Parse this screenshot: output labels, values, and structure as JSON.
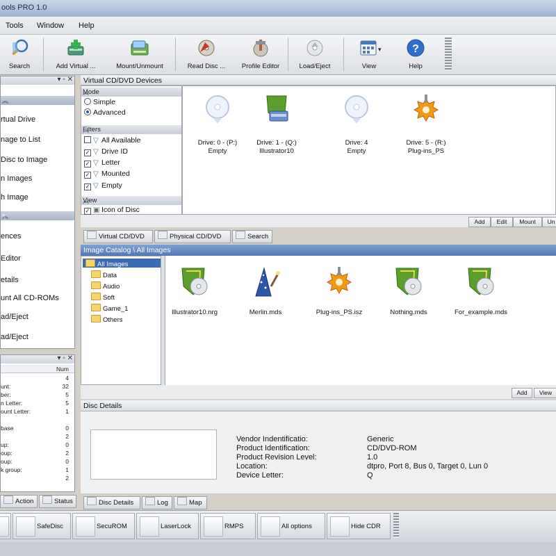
{
  "window": {
    "title": "ools PRO 1.0"
  },
  "menu": [
    "Tools",
    "Window",
    "Help"
  ],
  "toolbar": {
    "buttons": [
      "Search",
      "Add Virtual ...",
      "Mount/Unmount",
      "Read Disc ...",
      "Profile Editor",
      "Load/Eject",
      "View",
      "Help"
    ],
    "view_dropdown": "▾"
  },
  "left_tasks": {
    "group1": [
      "rtual Drive",
      "nage to List",
      "Disc to Image",
      "n Images",
      "h Image"
    ],
    "group2_header": "s",
    "group2": [
      "ences",
      "Editor",
      "etails",
      "unt All CD-ROMs",
      "ad/Eject",
      "ad/Eject"
    ]
  },
  "stats_table": {
    "header": [
      "",
      "Num"
    ],
    "rows": [
      {
        "label": "",
        "value": "4"
      },
      {
        "label": "unt:",
        "value": "32"
      },
      {
        "label": "ber:",
        "value": "5"
      },
      {
        "label": "n Letter:",
        "value": "5"
      },
      {
        "label": "ount Letter:",
        "value": "1"
      },
      {
        "label": "",
        "value": ""
      },
      {
        "label": "base",
        "value": "0"
      },
      {
        "label": "",
        "value": "2"
      },
      {
        "label": "up:",
        "value": "0"
      },
      {
        "label": "oup:",
        "value": "2"
      },
      {
        "label": "oup:",
        "value": "0"
      },
      {
        "label": "k group:",
        "value": "1"
      },
      {
        "label": "",
        "value": "2"
      }
    ],
    "tabs": [
      "Action",
      "Status"
    ]
  },
  "devices_panel": {
    "title": "Virtual CD/DVD Devices",
    "mode_header": "Mode",
    "mode_options": [
      "Simple",
      "Advanced"
    ],
    "filters_header": "Filters",
    "filters": [
      "All Available",
      "Drive ID",
      "Letter",
      "Mounted",
      "Empty"
    ],
    "view_header": "View",
    "view_options": [
      "Icon of Disc"
    ],
    "drives": [
      {
        "line1": "Drive: 0 - (P:)",
        "line2": "Empty",
        "icon": "disc-empty-icon"
      },
      {
        "line1": "Drive: 1 - (Q:)",
        "line2": "Illustrator10",
        "icon": "drive-shield-icon"
      },
      {
        "line1": "Drive: 4",
        "line2": "Empty",
        "icon": "disc-empty-icon"
      },
      {
        "line1": "Drive: 5 - (R:)",
        "line2": "Plug-ins_PS",
        "icon": "gear-plug-icon"
      }
    ],
    "buttons": [
      "Add",
      "Edit",
      "Mount",
      "Un"
    ]
  },
  "device_tabs": [
    "Virtual CD/DVD",
    "Physical CD/DVD",
    "Search"
  ],
  "catalog": {
    "title": "Image Catalog \\ All Images",
    "tree_root": "All Images",
    "tree": [
      "Data",
      "Audio",
      "Soft",
      "Game_1",
      "Others"
    ],
    "images": [
      {
        "label": "Illustrator10.nrg",
        "icon": "shield-disc-icon"
      },
      {
        "label": "Merlin.mds",
        "icon": "wizard-icon"
      },
      {
        "label": "Plug-ins_PS.isz",
        "icon": "gear-plug-icon"
      },
      {
        "label": "Nothing.mds",
        "icon": "shield-disc-icon"
      },
      {
        "label": "For_example.mds",
        "icon": "shield-disc-icon"
      }
    ],
    "buttons": [
      "Add",
      "View"
    ]
  },
  "disc_details": {
    "title": "Disc Details",
    "fields": [
      {
        "label": "Vendor Indentificatio:",
        "value": "Generic"
      },
      {
        "label": "Product Identification:",
        "value": "CD/DVD-ROM"
      },
      {
        "label": "Product Revision Level:",
        "value": "1.0"
      },
      {
        "label": "Location:",
        "value": "dtpro, Port 8, Bus 0, Target 0, Lun 0"
      },
      {
        "label": "Device Letter:",
        "value": "Q"
      }
    ],
    "tabs": [
      "Disc Details",
      "Log",
      "Map"
    ]
  },
  "bottom_buttons": [
    "",
    "SafeDisc",
    "SecuROM",
    "LaserLock",
    "RMPS",
    "All options",
    "Hide CDR"
  ],
  "colors": {
    "selection": "#5179b7",
    "shield_green": "#5a9e2c",
    "gear_orange": "#f29a17"
  }
}
